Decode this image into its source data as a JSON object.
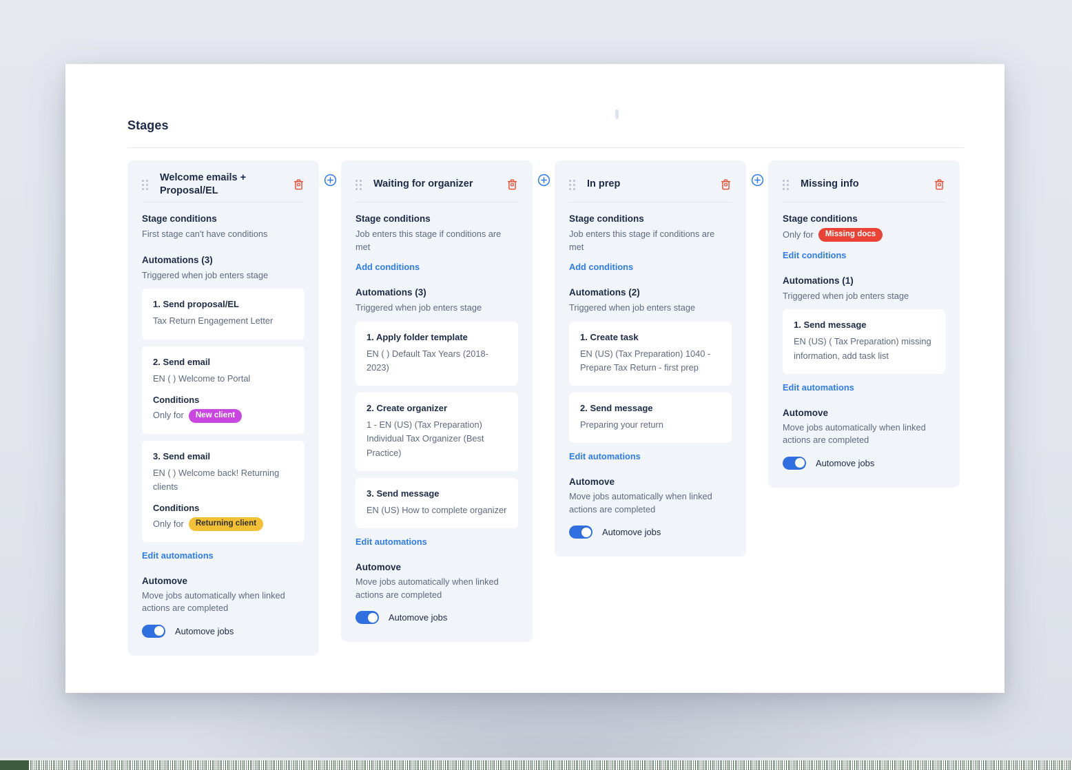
{
  "page": {
    "title": "Stages"
  },
  "colors": {
    "accent_link": "#2f7ced",
    "toggle_on": "#2f6fe0",
    "trash": "#e8553d",
    "plus": "#2f7ced",
    "badge_new_client_bg": "#c946e0",
    "badge_new_client_text": "#ffffff",
    "badge_returning_client_bg": "#f2c037",
    "badge_returning_client_text": "#32302a",
    "badge_missing_docs_bg": "#ea4335",
    "badge_missing_docs_text": "#ffffff",
    "column_bg": "#f1f4f9",
    "panel_bg": "#ffffff",
    "page_bg": "#e3e6ed"
  },
  "labels": {
    "stage_conditions": "Stage conditions",
    "automations_prefix": "Automations",
    "triggered_when": "Triggered when job enters stage",
    "conditions": "Conditions",
    "only_for": "Only for",
    "automove": "Automove",
    "automove_desc": "Move jobs automatically when linked actions are completed",
    "automove_toggle": "Automove jobs",
    "edit_automations": "Edit automations",
    "edit_conditions": "Edit conditions",
    "add_conditions": "Add conditions",
    "first_stage_no_conditions": "First stage can't have conditions",
    "job_enters_if_met": "Job enters this stage if conditions are met"
  },
  "icons": {
    "drag_handle": "drag-handle-icon",
    "trash": "trash-icon",
    "plus_circle": "plus-circle-icon"
  },
  "stages": [
    {
      "name": "Welcome emails + Proposal/EL",
      "conditions_text": "First stage can't have conditions",
      "conditions_link": null,
      "conditions_badge": null,
      "automations_count": "Automations (3)",
      "automations": [
        {
          "title": "1. Send proposal/EL",
          "desc": "Tax Return Engagement Letter",
          "condition_badge": null
        },
        {
          "title": "2. Send email",
          "desc": "EN ( ) Welcome to Portal",
          "condition_badge": "New client",
          "condition_badge_style": "new-client"
        },
        {
          "title": "3. Send email",
          "desc": "EN ( ) Welcome back! Returning clients",
          "condition_badge": "Returning client",
          "condition_badge_style": "returning-client"
        }
      ],
      "edit_automations": "Edit automations",
      "automove": {
        "title": "Automove",
        "desc": "Move jobs automatically when linked actions are completed",
        "toggle_label": "Automove jobs",
        "toggle_on": true
      }
    },
    {
      "name": "Waiting for organizer",
      "conditions_text": "Job enters this stage if conditions are met",
      "conditions_link": "Add conditions",
      "conditions_badge": null,
      "automations_count": "Automations (3)",
      "automations": [
        {
          "title": "1. Apply folder template",
          "desc": "EN ( ) Default Tax Years (2018-2023)",
          "condition_badge": null
        },
        {
          "title": "2. Create organizer",
          "desc": "1 - EN (US) (Tax Preparation) Individual Tax Organizer (Best Practice)",
          "condition_badge": null
        },
        {
          "title": "3. Send message",
          "desc": "EN (US) How to complete organizer",
          "condition_badge": null
        }
      ],
      "edit_automations": "Edit automations",
      "automove": {
        "title": "Automove",
        "desc": "Move jobs automatically when linked actions are completed",
        "toggle_label": "Automove jobs",
        "toggle_on": true
      }
    },
    {
      "name": "In prep",
      "conditions_text": "Job enters this stage if conditions are met",
      "conditions_link": "Add conditions",
      "conditions_badge": null,
      "automations_count": "Automations (2)",
      "automations": [
        {
          "title": "1. Create task",
          "desc": "EN (US) (Tax Preparation) 1040 - Prepare Tax Return - first prep",
          "condition_badge": null
        },
        {
          "title": "2. Send message",
          "desc": "Preparing your return",
          "condition_badge": null
        }
      ],
      "edit_automations": "Edit automations",
      "automove": {
        "title": "Automove",
        "desc": "Move jobs automatically when linked actions are completed",
        "toggle_label": "Automove jobs",
        "toggle_on": true
      }
    },
    {
      "name": "Missing info",
      "conditions_text": "Only for",
      "conditions_link": "Edit conditions",
      "conditions_badge": "Missing docs",
      "conditions_badge_style": "missing-docs",
      "automations_count": "Automations (1)",
      "automations": [
        {
          "title": "1. Send message",
          "desc": "EN (US) ( Tax Preparation) missing information, add task list",
          "condition_badge": null
        }
      ],
      "edit_automations": "Edit automations",
      "automove": {
        "title": "Automove",
        "desc": "Move jobs automatically when linked actions are completed",
        "toggle_label": "Automove jobs",
        "toggle_on": true
      }
    }
  ]
}
